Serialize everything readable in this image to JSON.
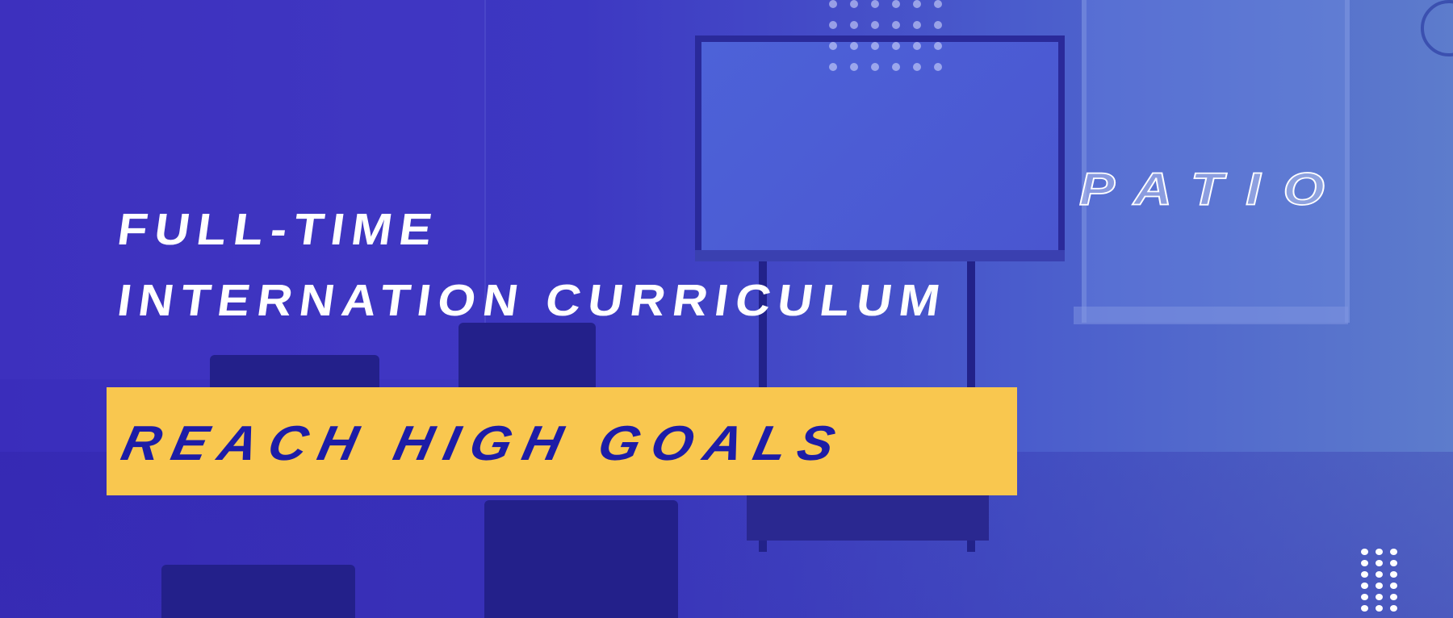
{
  "headline": {
    "line1": "FULL-TIME",
    "line2": "INTERNATION CURRICULUM"
  },
  "banner": {
    "text": "REACH HIGH GOALS",
    "background_color": "#f9c74f",
    "text_color": "#1d1ca6"
  },
  "brand": {
    "outline_text": "PATIO"
  },
  "colors": {
    "overlay_left": "#3a2dbb",
    "overlay_right": "#5d7ccc"
  }
}
